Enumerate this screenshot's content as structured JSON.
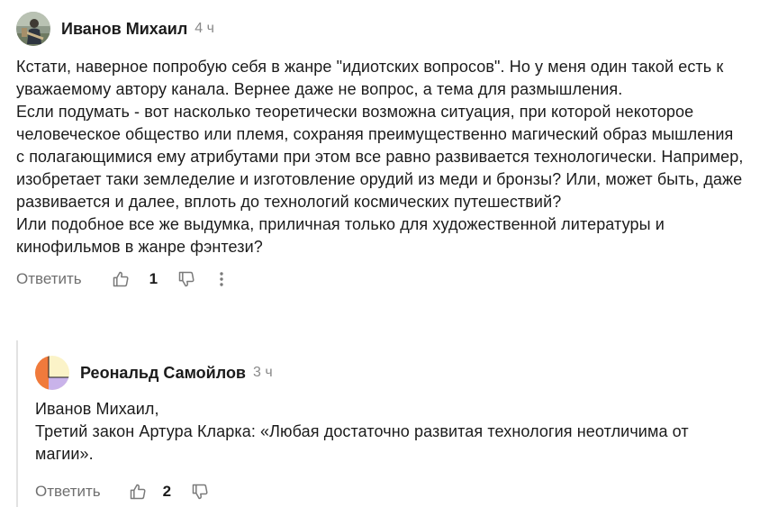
{
  "comment": {
    "author": "Иванов Михаил",
    "time": "4 ч",
    "paragraphs": [
      "Кстати, наверное попробую себя в жанре \"идиотских вопросов\". Но у меня один такой есть к уважаемому автору канала. Вернее даже не вопрос, а тема для размышления.",
      "Если подумать - вот насколько теоретически возможна ситуация, при которой некоторое человеческое общество или племя, сохраняя преимущественно магический образ мышления с полагающимися ему атрибутами при этом все равно развивается технологически. Например, изобретает таки земледелие и изготовление орудий из меди и бронзы? Или, может быть, даже развивается и далее, вплоть до технологий космических путешествий?",
      "Или подобное все же выдумка, приличная только для художественной литературы и кинофильмов в жанре фэнтези?"
    ],
    "reply_label": "Ответить",
    "likes": "1"
  },
  "reply": {
    "author": "Реональд Самойлов",
    "time": "3 ч",
    "paragraphs": [
      "Иванов Михаил,",
      "Третий закон Артура Кларка: «Любая достаточно развитая технология неотличима от магии»."
    ],
    "reply_label": "Ответить",
    "likes": "2"
  },
  "icons": {
    "like": "thumbs-up-icon",
    "dislike": "thumbs-down-icon",
    "more": "more-vertical-icon"
  },
  "colors": {
    "text": "#1b1b1b",
    "muted": "#8a8a8a",
    "action": "#6f6f6f",
    "thread_line": "#e2e2e2"
  }
}
